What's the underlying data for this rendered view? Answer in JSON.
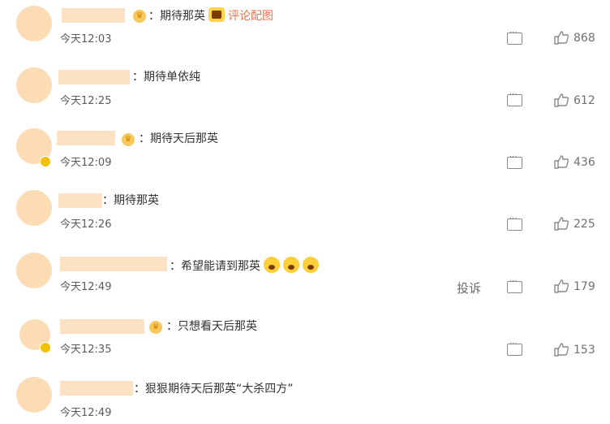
{
  "comments": [
    {
      "text": "：期待那英",
      "pic_link": "评论配图",
      "time": "今天12:03",
      "likes": "868"
    },
    {
      "text": "：期待单依纯",
      "time": "今天12:25",
      "likes": "612"
    },
    {
      "text": "：期待天后那英",
      "time": "今天12:09",
      "likes": "436"
    },
    {
      "text": "：期待那英",
      "time": "今天12:26",
      "likes": "225"
    },
    {
      "text": "：希望能请到那英",
      "time": "今天12:49",
      "likes": "179",
      "report": "投诉"
    },
    {
      "text": "：只想看天后那英",
      "time": "今天12:35",
      "likes": "153"
    },
    {
      "text": "：狠狠期待天后那英“大杀四方”",
      "time": "今天12:49"
    }
  ],
  "colors": {
    "avatar": "#fcdcb4",
    "name_blur": "#fde1c3",
    "link": "#eb7350",
    "icon": "#8a8a8a"
  },
  "icons": [
    "reply-icon",
    "like-icon",
    "crown-icon",
    "emoji-icon"
  ]
}
